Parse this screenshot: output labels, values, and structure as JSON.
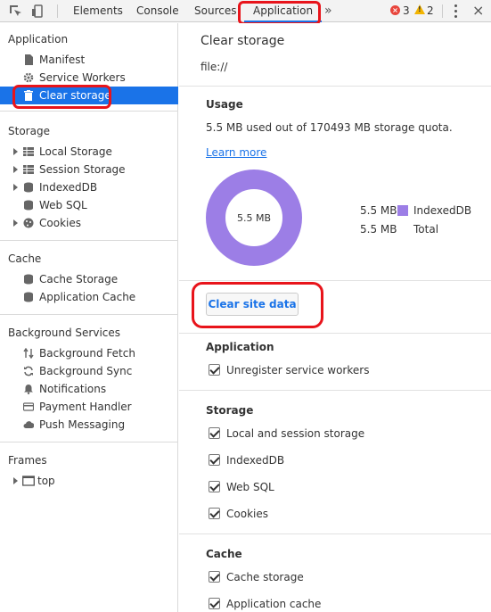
{
  "toolbar": {
    "tabs": [
      "Elements",
      "Console",
      "Sources",
      "Application"
    ],
    "more_icon": "double-chevron-right-icon",
    "errors": "3",
    "warnings": "2"
  },
  "sidebar": {
    "application_header": "Application",
    "application_items": [
      "Manifest",
      "Service Workers",
      "Clear storage"
    ],
    "storage_header": "Storage",
    "storage_items": [
      "Local Storage",
      "Session Storage",
      "IndexedDB",
      "Web SQL",
      "Cookies"
    ],
    "cache_header": "Cache",
    "cache_items": [
      "Cache Storage",
      "Application Cache"
    ],
    "bg_header": "Background Services",
    "bg_items": [
      "Background Fetch",
      "Background Sync",
      "Notifications",
      "Payment Handler",
      "Push Messaging"
    ],
    "frames_header": "Frames",
    "frames_items": [
      "top"
    ]
  },
  "main": {
    "title": "Clear storage",
    "origin": "file://",
    "usage_header": "Usage",
    "usage_text": "5.5 MB used out of 170493 MB storage quota.",
    "learn_more": "Learn more",
    "donut_label": "5.5 MB",
    "legend": [
      {
        "value": "5.5 MB",
        "label": "IndexedDB",
        "color": "#9c7ee6"
      },
      {
        "value": "5.5 MB",
        "label": "Total",
        "color": ""
      }
    ],
    "clear_button": "Clear site data",
    "application_header": "Application",
    "application_checks": [
      "Unregister service workers"
    ],
    "storage_header": "Storage",
    "storage_checks": [
      "Local and session storage",
      "IndexedDB",
      "Web SQL",
      "Cookies"
    ],
    "cache_header": "Cache",
    "cache_checks": [
      "Cache storage",
      "Application cache"
    ]
  },
  "colors": {
    "accent": "#1a73e8",
    "highlight": "#e8141b",
    "donut": "#9c7ee6"
  }
}
